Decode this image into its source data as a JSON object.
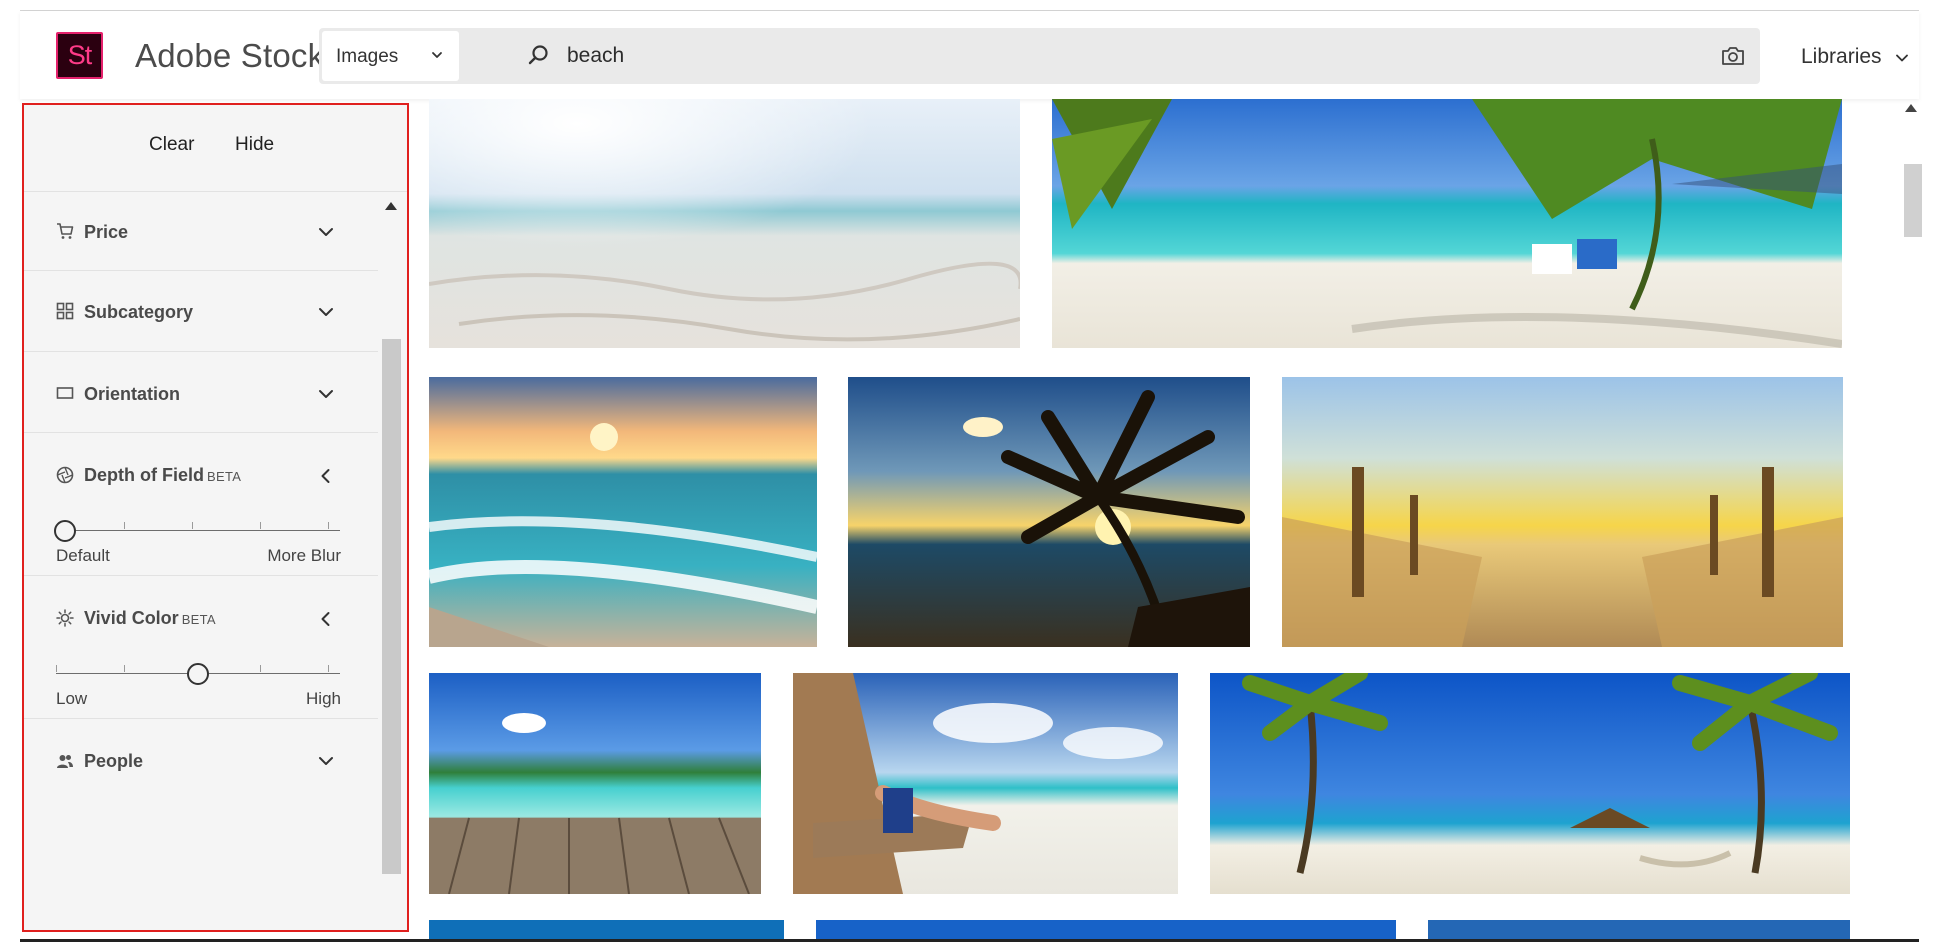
{
  "header": {
    "logo_text": "St",
    "brand": "Adobe Stock",
    "asset_type": "Images",
    "search_value": "beach",
    "libraries_label": "Libraries"
  },
  "sidebar": {
    "clear_label": "Clear",
    "hide_label": "Hide",
    "filters": {
      "price": "Price",
      "subcategory": "Subcategory",
      "orientation": "Orientation",
      "depth_of_field": "Depth of Field",
      "vivid_color": "Vivid Color",
      "people": "People"
    },
    "beta_label": "BETA",
    "depth_slider": {
      "min_label": "Default",
      "max_label": "More Blur",
      "value": 0
    },
    "vivid_slider": {
      "min_label": "Low",
      "max_label": "High",
      "value": 0.5
    }
  },
  "icons": {
    "price": "cart-icon",
    "subcategory": "grid-icon",
    "orientation": "rectangle-icon",
    "depth_of_field": "aperture-icon",
    "vivid_color": "sun-icon",
    "people": "people-icon"
  },
  "colors": {
    "brand_accent": "#e5216c",
    "highlight_border": "#e0201e"
  },
  "results": {
    "images": [
      "sandy beach blurred sea",
      "tropical beach with palm leaves and deck chairs",
      "sunset ocean waves",
      "palm tree silhouette at sunset",
      "wooden path to beach at sunrise",
      "tropical island from wooden pier",
      "woman relaxing on beach chair",
      "palm trees with hammock on beach"
    ]
  }
}
